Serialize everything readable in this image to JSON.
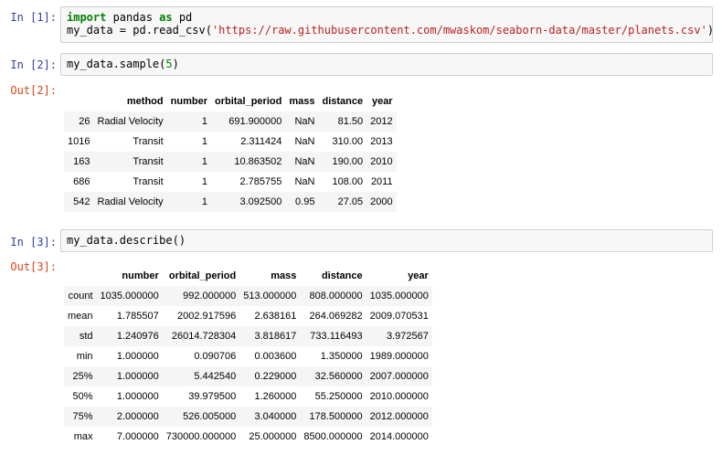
{
  "cells": {
    "c1": {
      "prompt": "In [1]:",
      "tokens": [
        {
          "cls": "kw",
          "t": "import"
        },
        {
          "cls": "plain",
          "t": " pandas "
        },
        {
          "cls": "kw",
          "t": "as"
        },
        {
          "cls": "plain",
          "t": " pd\nmy_data "
        },
        {
          "cls": "op",
          "t": "="
        },
        {
          "cls": "plain",
          "t": " pd.read_csv("
        },
        {
          "cls": "str",
          "t": "'https://raw.githubusercontent.com/mwaskom/seaborn-data/master/planets.csv'"
        },
        {
          "cls": "plain",
          "t": ")"
        }
      ]
    },
    "c2": {
      "prompt": "In [2]:",
      "out_prompt": "Out[2]:",
      "tokens": [
        {
          "cls": "plain",
          "t": "my_data.sample("
        },
        {
          "cls": "num",
          "t": "5"
        },
        {
          "cls": "plain",
          "t": ")"
        }
      ],
      "table": {
        "columns": [
          "",
          "method",
          "number",
          "orbital_period",
          "mass",
          "distance",
          "year"
        ],
        "rows": [
          [
            "26",
            "Radial Velocity",
            "1",
            "691.900000",
            "NaN",
            "81.50",
            "2012"
          ],
          [
            "1016",
            "Transit",
            "1",
            "2.311424",
            "NaN",
            "310.00",
            "2013"
          ],
          [
            "163",
            "Transit",
            "1",
            "10.863502",
            "NaN",
            "190.00",
            "2010"
          ],
          [
            "686",
            "Transit",
            "1",
            "2.785755",
            "NaN",
            "108.00",
            "2011"
          ],
          [
            "542",
            "Radial Velocity",
            "1",
            "3.092500",
            "0.95",
            "27.05",
            "2000"
          ]
        ]
      }
    },
    "c3": {
      "prompt": "In [3]:",
      "out_prompt": "Out[3]:",
      "tokens": [
        {
          "cls": "plain",
          "t": "my_data.describe()"
        }
      ],
      "table": {
        "columns": [
          "",
          "number",
          "orbital_period",
          "mass",
          "distance",
          "year"
        ],
        "rows": [
          [
            "count",
            "1035.000000",
            "992.000000",
            "513.000000",
            "808.000000",
            "1035.000000"
          ],
          [
            "mean",
            "1.785507",
            "2002.917596",
            "2.638161",
            "264.069282",
            "2009.070531"
          ],
          [
            "std",
            "1.240976",
            "26014.728304",
            "3.818617",
            "733.116493",
            "3.972567"
          ],
          [
            "min",
            "1.000000",
            "0.090706",
            "0.003600",
            "1.350000",
            "1989.000000"
          ],
          [
            "25%",
            "1.000000",
            "5.442540",
            "0.229000",
            "32.560000",
            "2007.000000"
          ],
          [
            "50%",
            "1.000000",
            "39.979500",
            "1.260000",
            "55.250000",
            "2010.000000"
          ],
          [
            "75%",
            "2.000000",
            "526.005000",
            "3.040000",
            "178.500000",
            "2012.000000"
          ],
          [
            "max",
            "7.000000",
            "730000.000000",
            "25.000000",
            "8500.000000",
            "2014.000000"
          ]
        ]
      }
    }
  },
  "colors": {
    "in_prompt": "#303f9f",
    "out_prompt": "#d84315",
    "keyword": "#008000",
    "string": "#ba2121",
    "number": "#008000",
    "input_bg": "#f7f7f7",
    "input_border": "#cfcfcf",
    "row_stripe": "#f5f5f5"
  }
}
